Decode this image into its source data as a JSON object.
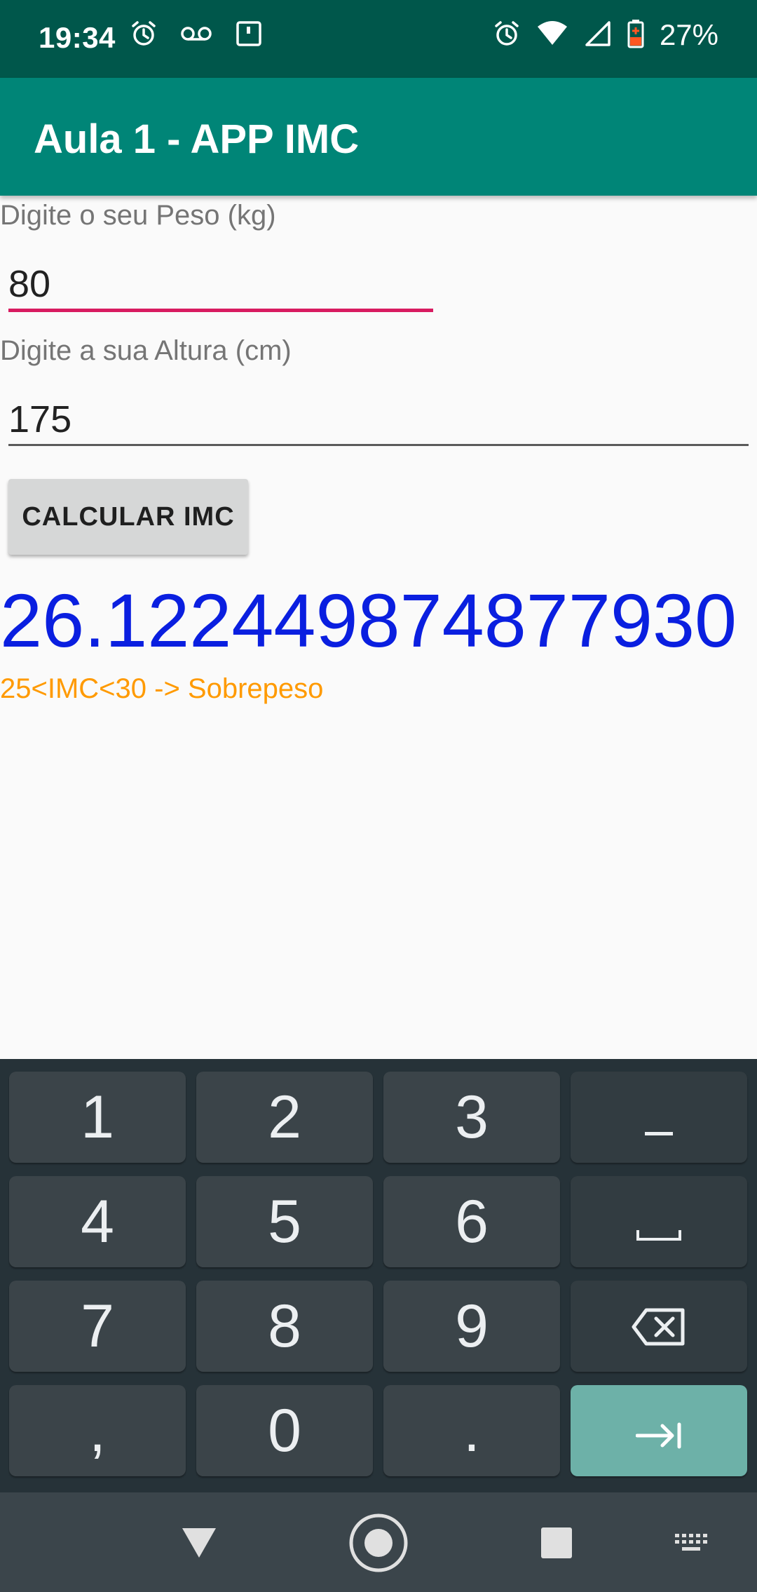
{
  "status_bar": {
    "time": "19:34",
    "battery_percent": "27%"
  },
  "app_bar": {
    "title": "Aula 1 - APP IMC"
  },
  "form": {
    "peso_label": "Digite o seu Peso (kg)",
    "peso_value": "80",
    "altura_label": "Digite a sua Altura (cm)",
    "altura_value": "175",
    "calc_button_label": "CALCULAR IMC"
  },
  "result": {
    "value": "26.122449874877930",
    "category": "25<IMC<30 -> Sobrepeso"
  },
  "keyboard": {
    "keys": [
      "1",
      "2",
      "3",
      "-",
      "4",
      "5",
      "6",
      "␣",
      "7",
      "8",
      "9",
      "⌫",
      ",",
      "0",
      ".",
      "⇥"
    ]
  },
  "colors": {
    "status_bar": "#00574b",
    "app_bar": "#008577",
    "accent": "#d81b60",
    "result_value": "#0a1fe0",
    "result_category": "#ff9a00",
    "keyboard_bg": "#263238",
    "enter_key": "#6db1a8"
  }
}
